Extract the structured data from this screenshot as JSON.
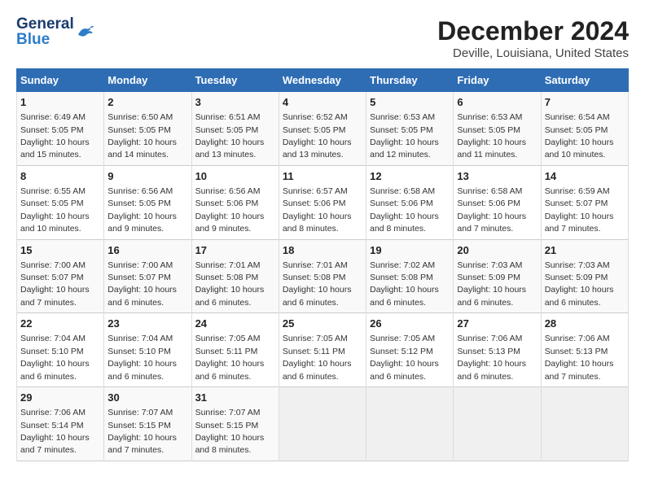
{
  "logo": {
    "general": "General",
    "blue": "Blue"
  },
  "title": "December 2024",
  "location": "Deville, Louisiana, United States",
  "days_of_week": [
    "Sunday",
    "Monday",
    "Tuesday",
    "Wednesday",
    "Thursday",
    "Friday",
    "Saturday"
  ],
  "weeks": [
    [
      {
        "day": "1",
        "info": "Sunrise: 6:49 AM\nSunset: 5:05 PM\nDaylight: 10 hours\nand 15 minutes."
      },
      {
        "day": "2",
        "info": "Sunrise: 6:50 AM\nSunset: 5:05 PM\nDaylight: 10 hours\nand 14 minutes."
      },
      {
        "day": "3",
        "info": "Sunrise: 6:51 AM\nSunset: 5:05 PM\nDaylight: 10 hours\nand 13 minutes."
      },
      {
        "day": "4",
        "info": "Sunrise: 6:52 AM\nSunset: 5:05 PM\nDaylight: 10 hours\nand 13 minutes."
      },
      {
        "day": "5",
        "info": "Sunrise: 6:53 AM\nSunset: 5:05 PM\nDaylight: 10 hours\nand 12 minutes."
      },
      {
        "day": "6",
        "info": "Sunrise: 6:53 AM\nSunset: 5:05 PM\nDaylight: 10 hours\nand 11 minutes."
      },
      {
        "day": "7",
        "info": "Sunrise: 6:54 AM\nSunset: 5:05 PM\nDaylight: 10 hours\nand 10 minutes."
      }
    ],
    [
      {
        "day": "8",
        "info": "Sunrise: 6:55 AM\nSunset: 5:05 PM\nDaylight: 10 hours\nand 10 minutes."
      },
      {
        "day": "9",
        "info": "Sunrise: 6:56 AM\nSunset: 5:05 PM\nDaylight: 10 hours\nand 9 minutes."
      },
      {
        "day": "10",
        "info": "Sunrise: 6:56 AM\nSunset: 5:06 PM\nDaylight: 10 hours\nand 9 minutes."
      },
      {
        "day": "11",
        "info": "Sunrise: 6:57 AM\nSunset: 5:06 PM\nDaylight: 10 hours\nand 8 minutes."
      },
      {
        "day": "12",
        "info": "Sunrise: 6:58 AM\nSunset: 5:06 PM\nDaylight: 10 hours\nand 8 minutes."
      },
      {
        "day": "13",
        "info": "Sunrise: 6:58 AM\nSunset: 5:06 PM\nDaylight: 10 hours\nand 7 minutes."
      },
      {
        "day": "14",
        "info": "Sunrise: 6:59 AM\nSunset: 5:07 PM\nDaylight: 10 hours\nand 7 minutes."
      }
    ],
    [
      {
        "day": "15",
        "info": "Sunrise: 7:00 AM\nSunset: 5:07 PM\nDaylight: 10 hours\nand 7 minutes."
      },
      {
        "day": "16",
        "info": "Sunrise: 7:00 AM\nSunset: 5:07 PM\nDaylight: 10 hours\nand 6 minutes."
      },
      {
        "day": "17",
        "info": "Sunrise: 7:01 AM\nSunset: 5:08 PM\nDaylight: 10 hours\nand 6 minutes."
      },
      {
        "day": "18",
        "info": "Sunrise: 7:01 AM\nSunset: 5:08 PM\nDaylight: 10 hours\nand 6 minutes."
      },
      {
        "day": "19",
        "info": "Sunrise: 7:02 AM\nSunset: 5:08 PM\nDaylight: 10 hours\nand 6 minutes."
      },
      {
        "day": "20",
        "info": "Sunrise: 7:03 AM\nSunset: 5:09 PM\nDaylight: 10 hours\nand 6 minutes."
      },
      {
        "day": "21",
        "info": "Sunrise: 7:03 AM\nSunset: 5:09 PM\nDaylight: 10 hours\nand 6 minutes."
      }
    ],
    [
      {
        "day": "22",
        "info": "Sunrise: 7:04 AM\nSunset: 5:10 PM\nDaylight: 10 hours\nand 6 minutes."
      },
      {
        "day": "23",
        "info": "Sunrise: 7:04 AM\nSunset: 5:10 PM\nDaylight: 10 hours\nand 6 minutes."
      },
      {
        "day": "24",
        "info": "Sunrise: 7:05 AM\nSunset: 5:11 PM\nDaylight: 10 hours\nand 6 minutes."
      },
      {
        "day": "25",
        "info": "Sunrise: 7:05 AM\nSunset: 5:11 PM\nDaylight: 10 hours\nand 6 minutes."
      },
      {
        "day": "26",
        "info": "Sunrise: 7:05 AM\nSunset: 5:12 PM\nDaylight: 10 hours\nand 6 minutes."
      },
      {
        "day": "27",
        "info": "Sunrise: 7:06 AM\nSunset: 5:13 PM\nDaylight: 10 hours\nand 6 minutes."
      },
      {
        "day": "28",
        "info": "Sunrise: 7:06 AM\nSunset: 5:13 PM\nDaylight: 10 hours\nand 7 minutes."
      }
    ],
    [
      {
        "day": "29",
        "info": "Sunrise: 7:06 AM\nSunset: 5:14 PM\nDaylight: 10 hours\nand 7 minutes."
      },
      {
        "day": "30",
        "info": "Sunrise: 7:07 AM\nSunset: 5:15 PM\nDaylight: 10 hours\nand 7 minutes."
      },
      {
        "day": "31",
        "info": "Sunrise: 7:07 AM\nSunset: 5:15 PM\nDaylight: 10 hours\nand 8 minutes."
      },
      {
        "day": "",
        "info": ""
      },
      {
        "day": "",
        "info": ""
      },
      {
        "day": "",
        "info": ""
      },
      {
        "day": "",
        "info": ""
      }
    ]
  ]
}
